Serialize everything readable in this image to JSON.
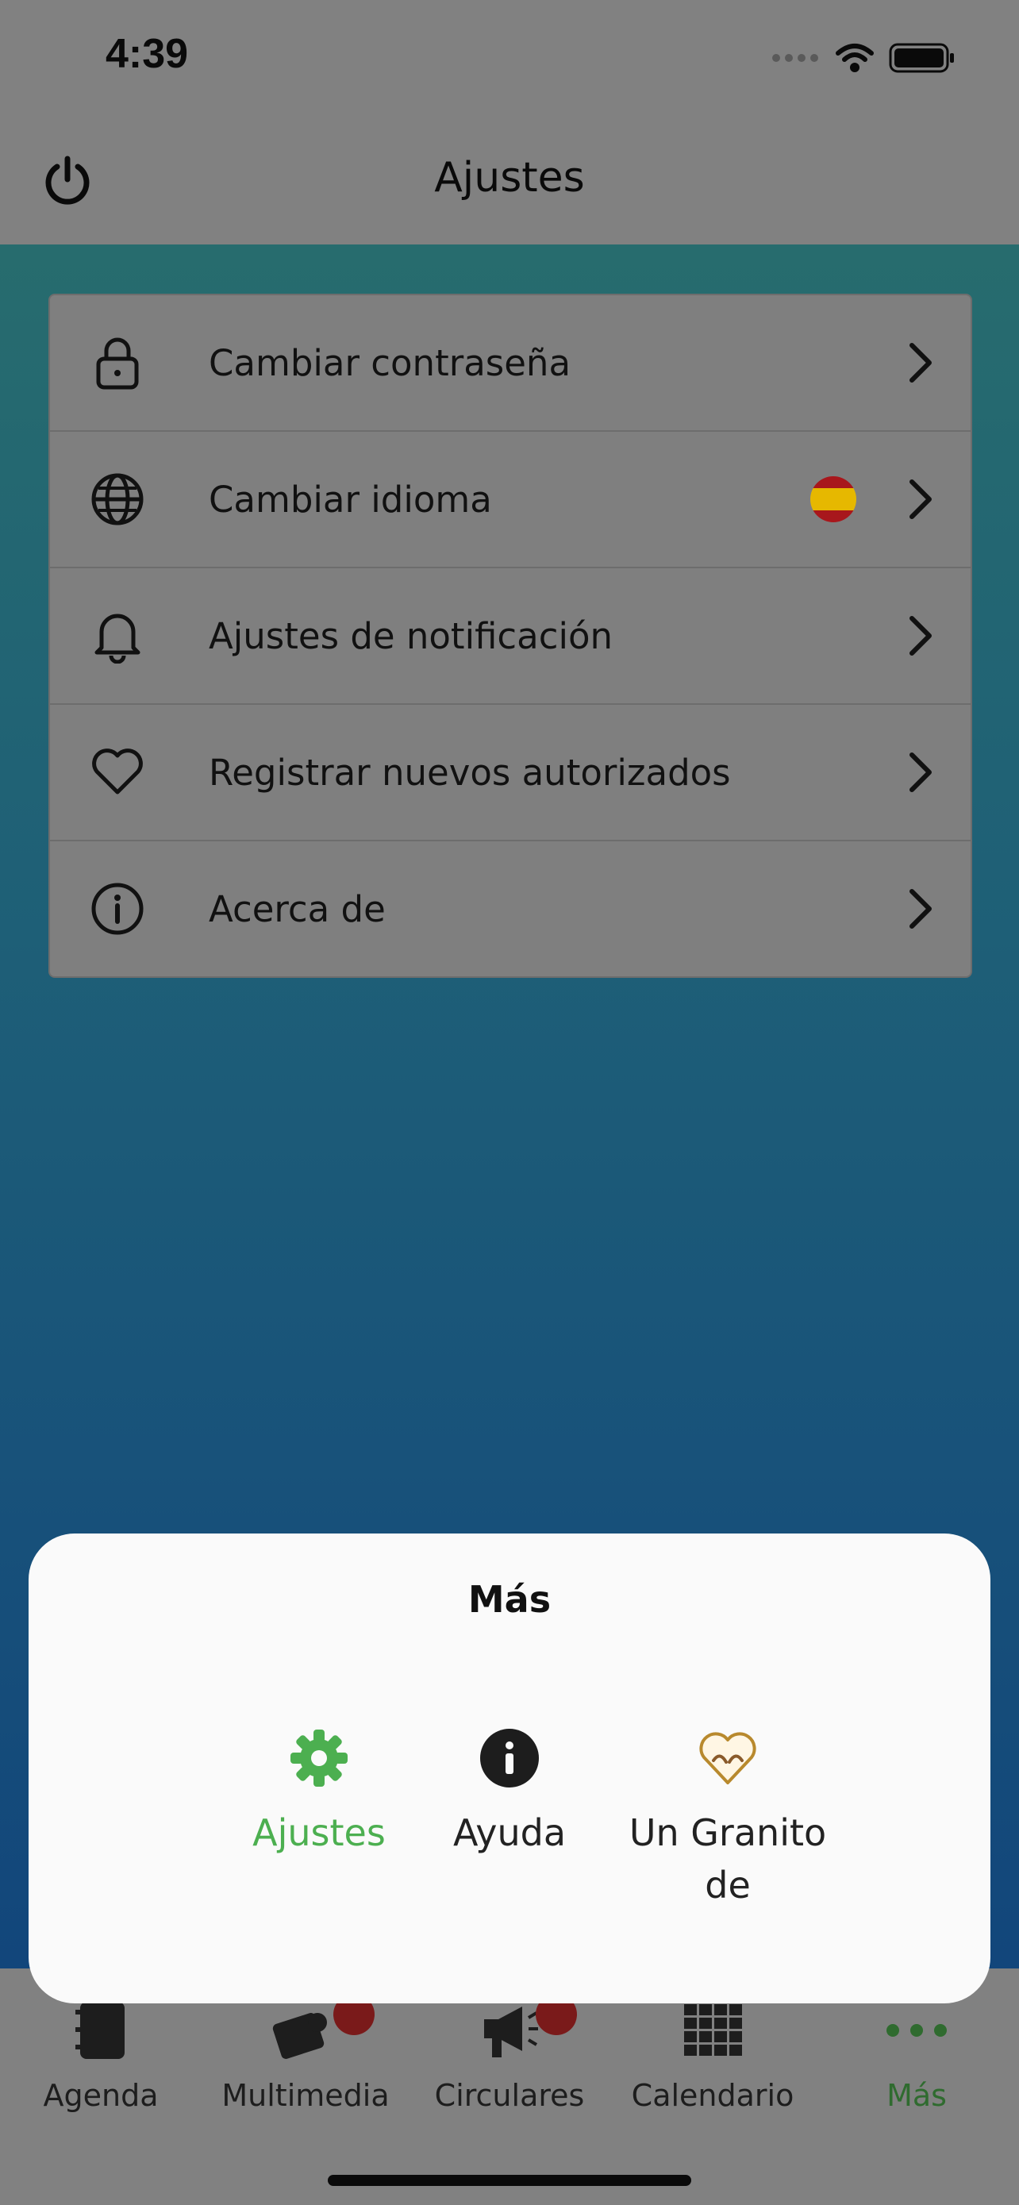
{
  "status_bar": {
    "time": "4:39"
  },
  "nav": {
    "title": "Ajustes"
  },
  "settings": {
    "items": [
      {
        "label": "Cambiar contraseña",
        "icon": "lock-icon"
      },
      {
        "label": "Cambiar idioma",
        "icon": "globe-icon",
        "flag": "spain-flag-icon"
      },
      {
        "label": "Ajustes de notificación",
        "icon": "bell-icon"
      },
      {
        "label": "Registrar nuevos autorizados",
        "icon": "heart-icon"
      },
      {
        "label": "Acerca de",
        "icon": "info-icon"
      }
    ]
  },
  "sheet": {
    "title": "Más",
    "options": [
      {
        "label": "Ajustes",
        "icon": "gear-icon",
        "active": true
      },
      {
        "label": "Ayuda",
        "icon": "info-circle-icon",
        "active": false
      },
      {
        "label": "Un Granito de",
        "icon": "hands-heart-logo",
        "active": false
      }
    ]
  },
  "tabbar": {
    "tabs": [
      {
        "label": "Agenda",
        "icon": "agenda-icon"
      },
      {
        "label": "Multimedia",
        "icon": "multimedia-icon"
      },
      {
        "label": "Circulares",
        "icon": "megaphone-icon"
      },
      {
        "label": "Calendario",
        "icon": "calendar-grid-icon"
      },
      {
        "label": "Más",
        "icon": "more-dots-icon",
        "active": true
      }
    ]
  },
  "colors": {
    "accent": "#4caf50",
    "tab_active": "#2f6b2f"
  }
}
